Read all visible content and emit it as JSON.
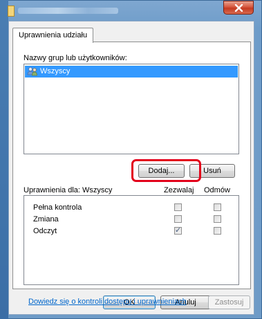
{
  "window": {
    "title": "",
    "close_glyph": "✕"
  },
  "tabs": [
    {
      "label": "Uprawnienia udziału"
    }
  ],
  "groups": {
    "label": "Nazwy grup lub użytkowników:",
    "items": [
      {
        "name": "Wszyscy",
        "icon": "users-icon",
        "selected": true
      }
    ],
    "add_button": "Dodaj...",
    "remove_button": "Usuń"
  },
  "permissions": {
    "label": "Uprawnienia dla: Wszyscy",
    "allow_header": "Zezwalaj",
    "deny_header": "Odmów",
    "rows": [
      {
        "name": "Pełna kontrola",
        "allow": false,
        "deny": false
      },
      {
        "name": "Zmiana",
        "allow": false,
        "deny": false
      },
      {
        "name": "Odczyt",
        "allow": true,
        "deny": false
      }
    ]
  },
  "link_text": "Dowiedz się o kontroli dostępu i uprawnieniach",
  "footer": {
    "ok": "OK",
    "cancel": "Anuluj",
    "apply": "Zastosuj"
  },
  "colors": {
    "selection": "#3399ff",
    "highlight_border": "#e3001b",
    "link": "#0066cc"
  }
}
